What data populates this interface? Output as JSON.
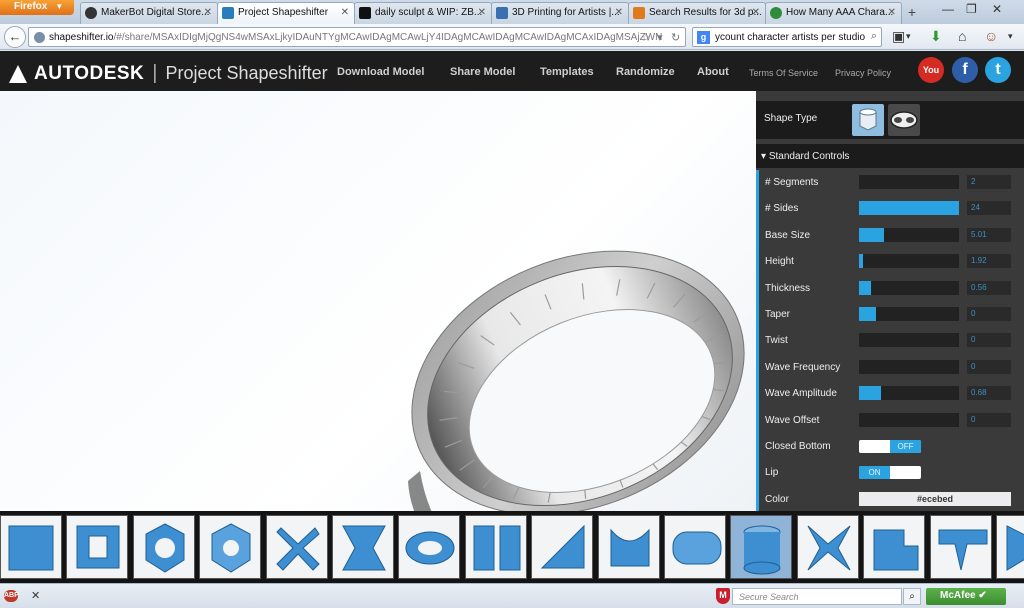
{
  "browser": {
    "menu_button": "Firefox",
    "tabs": [
      {
        "title": "MakerBot Digital Store...",
        "favicon_color": "#333333",
        "active": false
      },
      {
        "title": "Project Shapeshifter",
        "favicon_color": "#2a7dbd",
        "active": true
      },
      {
        "title": "daily sculpt & WIP: ZB...",
        "favicon_color": "#111111",
        "active": false
      },
      {
        "title": "3D Printing for Artists |...",
        "favicon_color": "#3a6fb0",
        "active": false
      },
      {
        "title": "Search Results for 3d p...",
        "favicon_color": "#e07a1a",
        "active": false
      },
      {
        "title": "How Many AAA Chara...",
        "favicon_color": "#2e8b3a",
        "active": false
      }
    ],
    "url_host": "shapeshifter.io",
    "url_path": "/#/share/MSAxIDIgMjQgNS4wMSAxLjkyIDAuNTYgMCAwIDAgMCAwLjY4IDAgMCAwIDAgMCAwIDAgMCAxIDAgMSAjZWN",
    "search_text": "ycount character artists per studio"
  },
  "site": {
    "brand": "AUTODESK",
    "product": "Project Shapeshifter",
    "nav": [
      "Download Model",
      "Share Model",
      "Templates",
      "Randomize",
      "About"
    ],
    "small_links": [
      "Terms Of Service",
      "Privacy Policy"
    ],
    "social": [
      {
        "name": "youtube",
        "label": "You",
        "color": "#d62b23"
      },
      {
        "name": "facebook",
        "label": "f",
        "color": "#2f5ea8"
      },
      {
        "name": "twitter",
        "label": "t",
        "color": "#2aa3e0"
      }
    ]
  },
  "panel": {
    "shape_type_label": "Shape Type",
    "section_title": "Standard Controls",
    "controls": [
      {
        "label": "# Segments",
        "value": "2",
        "fill": 0.0
      },
      {
        "label": "# Sides",
        "value": "24",
        "fill": 1.0
      },
      {
        "label": "Base Size",
        "value": "5.01",
        "fill": 0.25
      },
      {
        "label": "Height",
        "value": "1.92",
        "fill": 0.04
      },
      {
        "label": "Thickness",
        "value": "0.56",
        "fill": 0.12
      },
      {
        "label": "Taper",
        "value": "0",
        "fill": 0.17
      },
      {
        "label": "Twist",
        "value": "0",
        "fill": 0.0
      },
      {
        "label": "Wave Frequency",
        "value": "0",
        "fill": 0.0
      },
      {
        "label": "Wave Amplitude",
        "value": "0.68",
        "fill": 0.22
      },
      {
        "label": "Wave Offset",
        "value": "0",
        "fill": 0.0
      }
    ],
    "closed_bottom": {
      "label": "Closed Bottom",
      "state": "OFF"
    },
    "lip": {
      "label": "Lip",
      "state": "ON"
    },
    "color": {
      "label": "Color",
      "value": "#ecebed"
    }
  },
  "status": {
    "addon_badge": "ABP",
    "secure_search_placeholder": "Secure Search",
    "mcafee_label": "McAfee"
  }
}
